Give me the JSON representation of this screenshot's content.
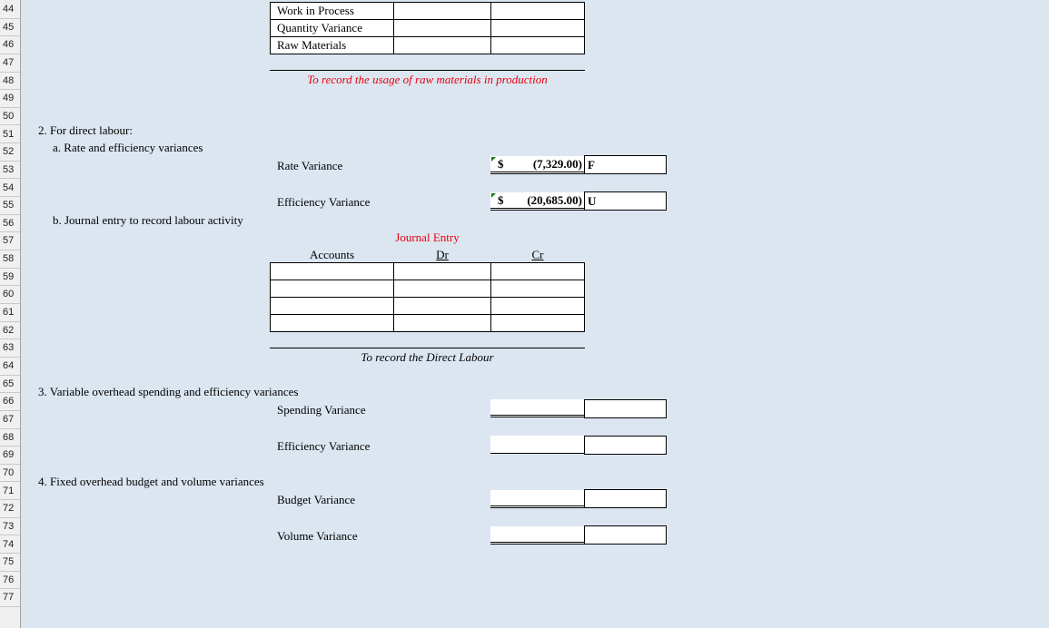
{
  "row_headers": [
    "44",
    "45",
    "46",
    "47",
    "48",
    "49",
    "50",
    "51",
    "52",
    "53",
    "54",
    "55",
    "56",
    "57",
    "58",
    "59",
    "60",
    "61",
    "62",
    "63",
    "64",
    "65",
    "66",
    "67",
    "68",
    "69",
    "70",
    "71",
    "72",
    "73",
    "74",
    "75",
    "76",
    "77"
  ],
  "materials_entry": {
    "rows": [
      {
        "account": "Work in Process",
        "dr": "",
        "cr": ""
      },
      {
        "account": "Quantity Variance",
        "dr": "",
        "cr": ""
      },
      {
        "account": "Raw Materials",
        "dr": "",
        "cr": ""
      }
    ],
    "memo": "To record the usage of raw materials in production"
  },
  "labour": {
    "heading": "2. For direct labour:",
    "sub_a": "a. Rate and efficiency variances",
    "rate_label": "Rate Variance",
    "rate_currency": "$",
    "rate_value": "(7,329.00)",
    "rate_flag": "F",
    "eff_label": "Efficiency Variance",
    "eff_currency": "$",
    "eff_value": "(20,685.00)",
    "eff_flag": "U",
    "sub_b": "b. Journal entry to record labour activity",
    "journal_title": "Journal Entry",
    "col_accounts": "Accounts",
    "col_dr": "Dr",
    "col_cr": "Cr",
    "rows": [
      {
        "account": "",
        "dr": "",
        "cr": ""
      },
      {
        "account": "",
        "dr": "",
        "cr": ""
      },
      {
        "account": "",
        "dr": "",
        "cr": ""
      },
      {
        "account": "",
        "dr": "",
        "cr": ""
      }
    ],
    "memo": "To record the Direct Labour"
  },
  "variable_overhead": {
    "heading": "3. Variable overhead spending and efficiency variances",
    "spending_label": "Spending Variance",
    "spending_value": "",
    "spending_flag": "",
    "efficiency_label": "Efficiency Variance",
    "efficiency_value": "",
    "efficiency_flag": ""
  },
  "fixed_overhead": {
    "heading": "4. Fixed overhead budget and volume variances",
    "budget_label": "Budget Variance",
    "budget_value": "",
    "budget_flag": "",
    "volume_label": "Volume Variance",
    "volume_value": "",
    "volume_flag": ""
  }
}
